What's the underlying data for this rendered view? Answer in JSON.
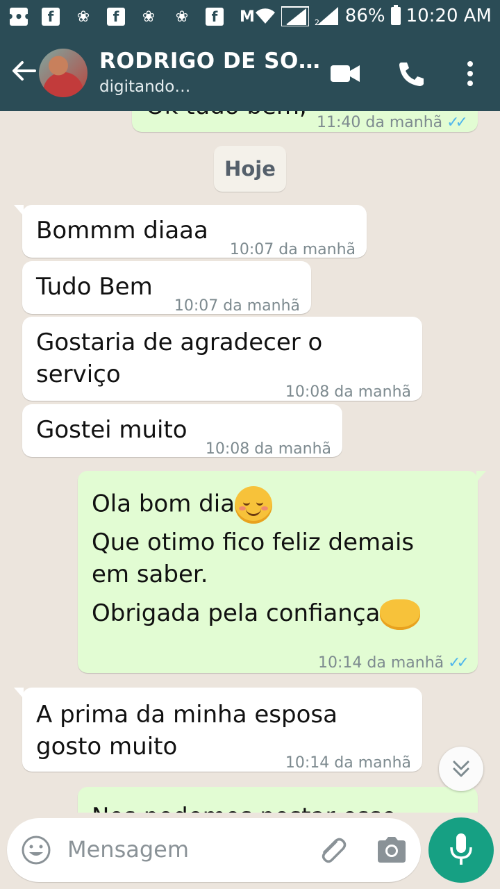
{
  "statusbar": {
    "battery_pct": "86%",
    "time": "10:20 AM"
  },
  "header": {
    "contact_name": "RODRIGO DE SO…",
    "contact_status": "digitando…"
  },
  "chat": {
    "top_partial": {
      "text": "Ok tudo bem,",
      "time": "11:40 da manhã"
    },
    "date_chip": "Hoje",
    "messages": [
      {
        "text": "Bommm diaaa",
        "time": "10:07 da manhã"
      },
      {
        "text": "Tudo Bem",
        "time": "10:07 da manhã"
      },
      {
        "line1": "Gostaria de agradecer o",
        "line2": "serviço",
        "time": "10:08 da manhã"
      },
      {
        "text": "Gostei muito",
        "time": "10:08 da manhã"
      },
      {
        "line1": "Ola bom dia",
        "line2": "Que otimo fico feliz demais",
        "line3": "em saber.",
        "line4": "Obrigada pela confiança",
        "time": "10:14 da manhã"
      },
      {
        "line1": "A prima da minha esposa",
        "line2": "gosto muito",
        "time": "10:14 da manhã"
      },
      {
        "text": "Nos podemos postar esse"
      }
    ]
  },
  "input": {
    "placeholder": "Mensagem"
  },
  "icons": {
    "ticks": "✓✓"
  }
}
